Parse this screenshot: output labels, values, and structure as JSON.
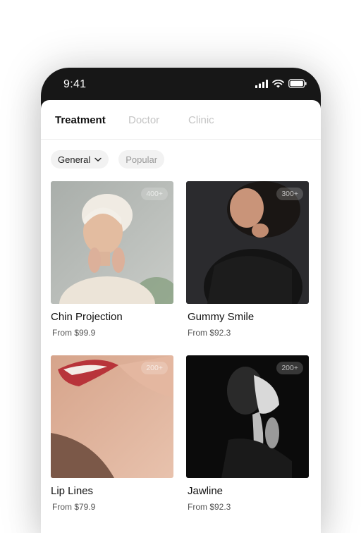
{
  "status": {
    "time": "9:41"
  },
  "tabs": [
    {
      "label": "Treatment",
      "active": true
    },
    {
      "label": "Doctor",
      "active": false
    },
    {
      "label": "Clinic",
      "active": false
    }
  ],
  "filters": [
    {
      "label": "General"
    },
    {
      "label": "Popular"
    }
  ],
  "cards": [
    {
      "title": "Chin Projection",
      "price": "From $99.9",
      "badge": "400+"
    },
    {
      "title": "Gummy Smile",
      "price": "From $92.3",
      "badge": "300+"
    },
    {
      "title": "Lip Lines",
      "price": "From $79.9",
      "badge": "200+"
    },
    {
      "title": "Jawline",
      "price": "From $92.3",
      "badge": "200+"
    }
  ],
  "colors": {
    "frame": "#171717",
    "active_tab": "#111111",
    "inactive_tab": "#c4c4c4",
    "chip_bg": "#f2f2f2"
  },
  "icons": [
    "signal-icon",
    "wifi-icon",
    "battery-icon",
    "chevron-down-icon"
  ]
}
